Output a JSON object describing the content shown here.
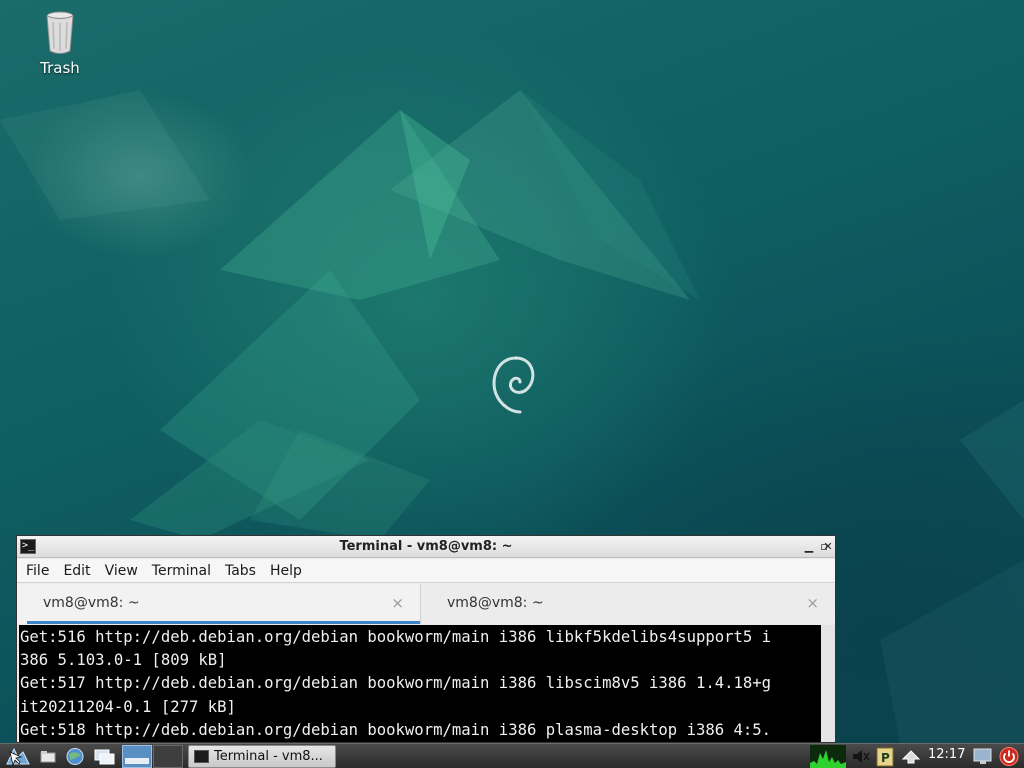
{
  "desktop": {
    "icons": [
      {
        "label": "Trash",
        "icon": "trash-icon"
      }
    ],
    "center_logo": "debian-swirl-icon"
  },
  "window": {
    "title": "Terminal - vm8@vm8: ~",
    "app_icon": "terminal-icon",
    "controls": {
      "minimize": "▁",
      "maximize": "▫",
      "close": "✕"
    },
    "menu": [
      "File",
      "Edit",
      "View",
      "Terminal",
      "Tabs",
      "Help"
    ],
    "tabs": [
      {
        "label": "vm8@vm8: ~",
        "close": "×",
        "active": true
      },
      {
        "label": "vm8@vm8: ~",
        "close": "×",
        "active": false
      }
    ],
    "terminal_lines": [
      "Get:516 http://deb.debian.org/debian bookworm/main i386 libkf5kdelibs4support5 i",
      "386 5.103.0-1 [809 kB]",
      "Get:517 http://deb.debian.org/debian bookworm/main i386 libscim8v5 i386 1.4.18+g",
      "it20211204-0.1 [277 kB]",
      "Get:518 http://deb.debian.org/debian bookworm/main i386 plasma-desktop i386 4:5."
    ]
  },
  "panel": {
    "launchers": [
      "menu-icon",
      "file-manager-icon",
      "web-browser-icon",
      "show-desktop-icon"
    ],
    "workspaces": [
      "workspace-1",
      "workspace-2"
    ],
    "task": {
      "label": "Terminal - vm8...",
      "icon": "terminal-icon"
    },
    "tray": [
      "cpu-monitor-icon",
      "volume-icon",
      "clipboard-icon",
      "network-icon"
    ],
    "clock": "12:17",
    "end_icons": [
      "display-icon",
      "power-icon"
    ]
  },
  "colors": {
    "wallpaper": "#0f5f62",
    "terminal_bg": "#000000",
    "terminal_fg": "#f0f0f0",
    "tab_accent": "#3d84c6",
    "panel": "#333333"
  }
}
